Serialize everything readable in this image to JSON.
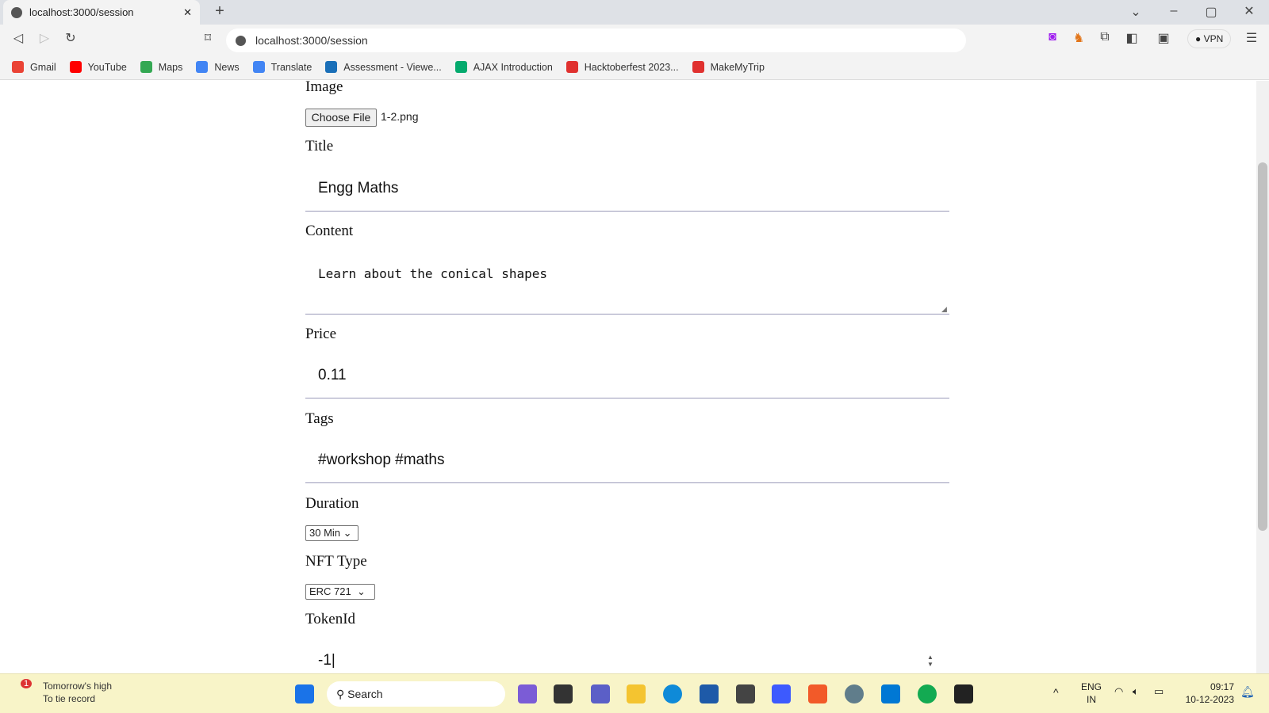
{
  "browser": {
    "tab_title": "localhost:3000/session",
    "new_tab": "+",
    "url": "localhost:3000/session",
    "vpn_label": "VPN",
    "bookmarks": [
      {
        "label": "Gmail",
        "icon": "gmail-icon",
        "color": "#ea4335"
      },
      {
        "label": "YouTube",
        "icon": "youtube-icon",
        "color": "#ff0000"
      },
      {
        "label": "Maps",
        "icon": "maps-icon",
        "color": "#34a853"
      },
      {
        "label": "News",
        "icon": "news-icon",
        "color": "#4285f4"
      },
      {
        "label": "Translate",
        "icon": "translate-icon",
        "color": "#4285f4"
      },
      {
        "label": "Assessment - Viewe...",
        "icon": "assessment-icon",
        "color": "#1a6fb8"
      },
      {
        "label": "AJAX Introduction",
        "icon": "w3schools-icon",
        "color": "#04aa6d"
      },
      {
        "label": "Hacktoberfest 2023...",
        "icon": "hacktoberfest-icon",
        "color": "#e0312f"
      },
      {
        "label": "MakeMyTrip",
        "icon": "makemytrip-icon",
        "color": "#e0312f"
      }
    ]
  },
  "form": {
    "image_label": "Image",
    "choose_file": "Choose File",
    "file_name": "1-2.png",
    "title_label": "Title",
    "title_value": "Engg Maths",
    "content_label": "Content",
    "content_value": "Learn about the conical shapes",
    "price_label": "Price",
    "price_value": "0.11",
    "tags_label": "Tags",
    "tags_value": "#workshop #maths",
    "duration_label": "Duration",
    "duration_value": "30 Min",
    "nft_label": "NFT Type",
    "nft_value": "ERC 721",
    "token_label": "TokenId",
    "token_value": "-1"
  },
  "taskbar": {
    "weather_line1": "Tomorrow's high",
    "weather_line2": "To tie record",
    "weather_badge": "1",
    "search": "Search",
    "lang1": "ENG",
    "lang2": "IN",
    "time": "09:17",
    "date": "10-12-2023"
  }
}
